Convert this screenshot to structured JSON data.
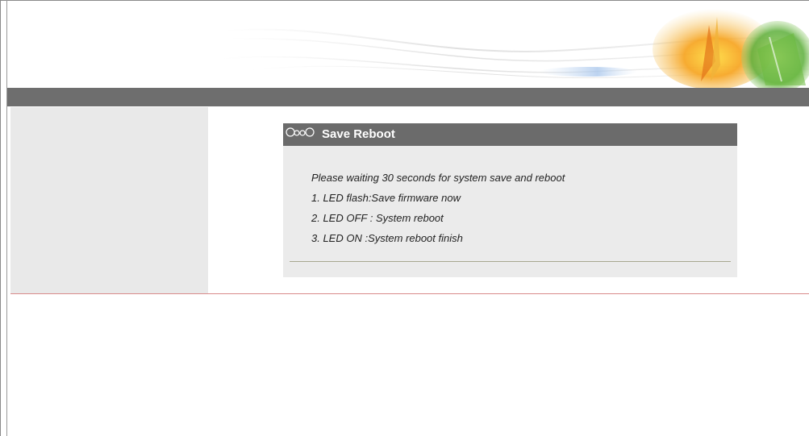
{
  "panel": {
    "title": "Save Reboot",
    "icon": "chain-link-icon",
    "messages": [
      "Please waiting 30 seconds for system save and reboot",
      "1. LED flash:Save firmware now",
      "2. LED OFF : System reboot",
      "3. LED ON :System reboot finish"
    ]
  },
  "colors": {
    "navbar": "#6e6e6e",
    "sidebar": "#e9e9e9",
    "panel_header": "#6b6b6b",
    "panel_body": "#ebebeb",
    "divider": "#d98a8a"
  }
}
